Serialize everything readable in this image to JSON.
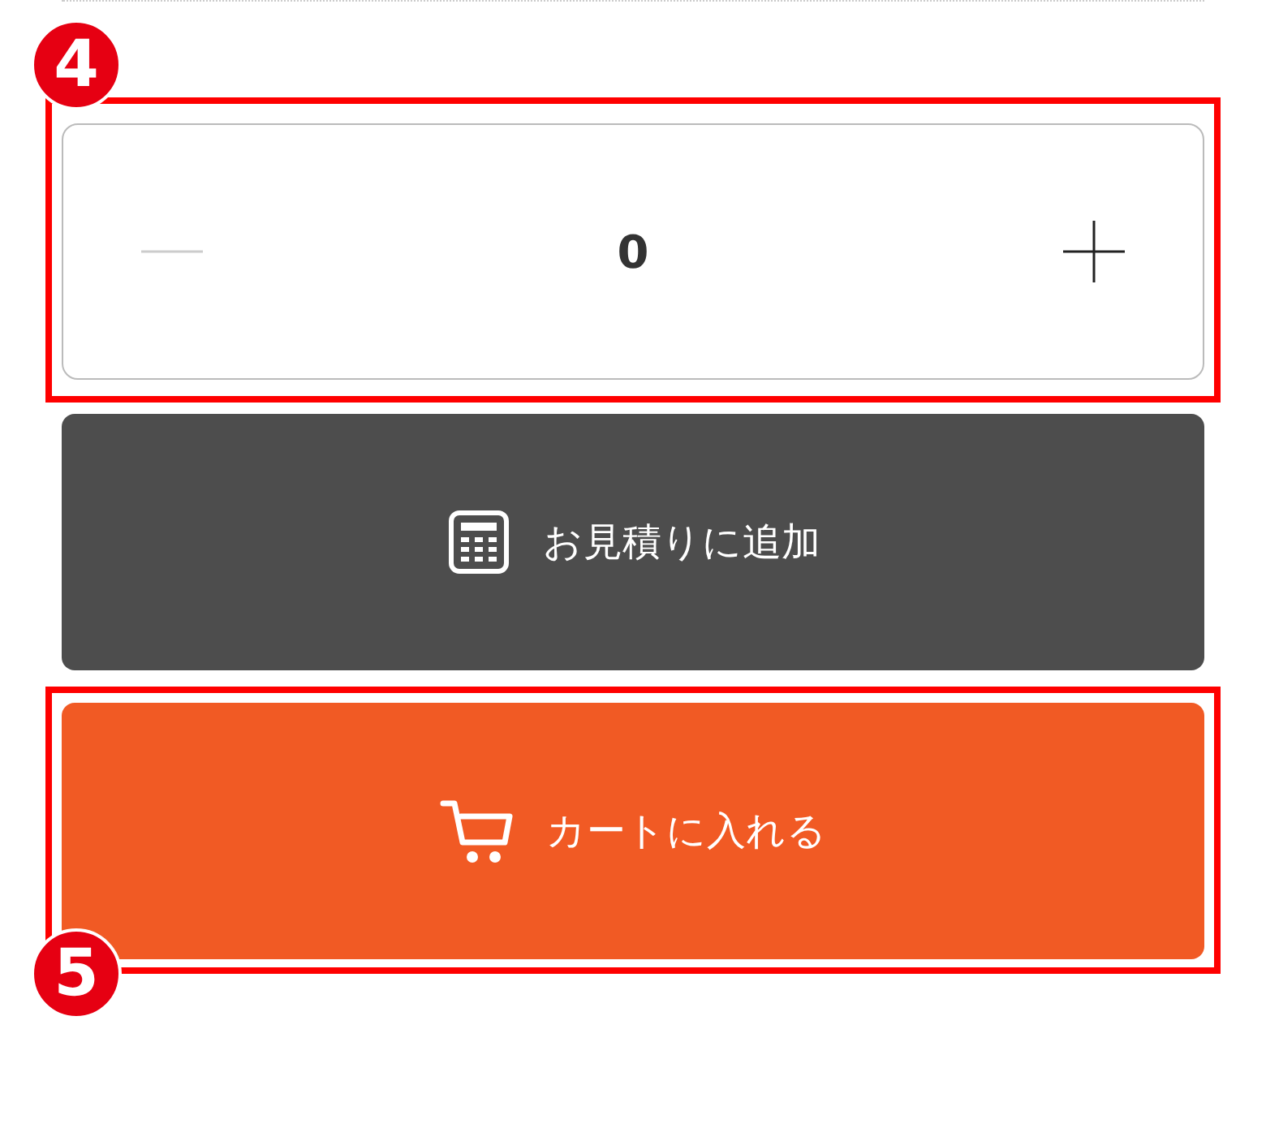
{
  "quantity": {
    "annotation": "4",
    "minus_disabled": true,
    "value": "0"
  },
  "quote_button": {
    "label": "お見積りに追加"
  },
  "cart_button": {
    "annotation": "5",
    "label": "カートに入れる"
  }
}
